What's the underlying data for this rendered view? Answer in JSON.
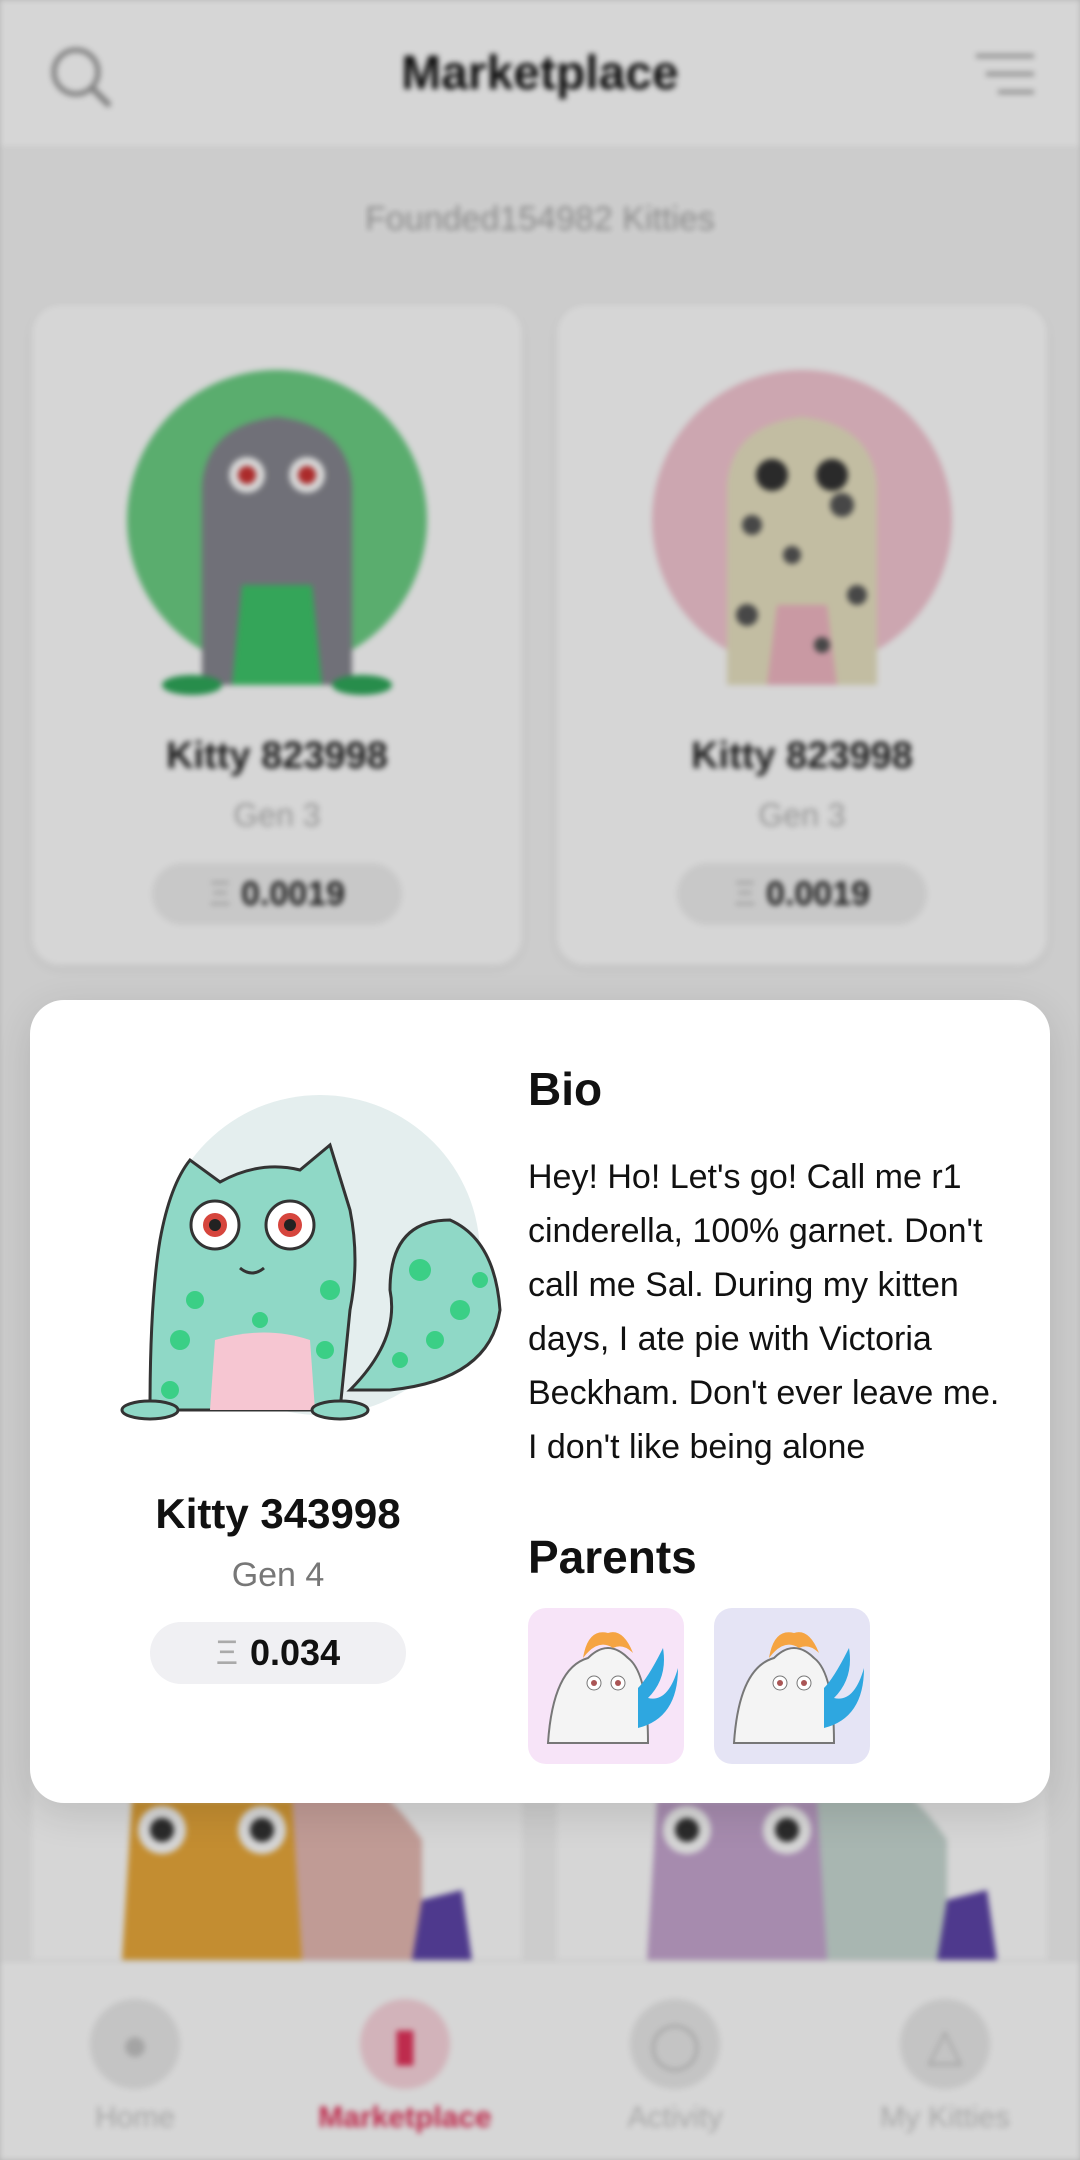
{
  "header": {
    "title": "Marketplace",
    "search_icon": "search-icon",
    "filter_icon": "filter-icon"
  },
  "found_text": "Founded154982 Kitties",
  "grid": [
    {
      "name": "Kitty 823998",
      "gen": "Gen 3",
      "price": "0.0019",
      "bg": "#6cce84"
    },
    {
      "name": "Kitty 823998",
      "gen": "Gen 3",
      "price": "0.0019",
      "bg": "#f4c6d2"
    }
  ],
  "modal": {
    "name": "Kitty 343998",
    "gen": "Gen 4",
    "price": "0.034",
    "currency_symbol": "Ξ",
    "bio_title": "Bio",
    "bio": "Hey! Ho! Let's go! Call me r1 cinderella, 100% garnet. Don't call me Sal. During my kitten days, I ate pie with Victoria Beckham. Don't ever leave me. I don't like being alone",
    "parents_title": "Parents",
    "parents": [
      {
        "bg": "#f7e4f8"
      },
      {
        "bg": "#e5e4f5"
      }
    ]
  },
  "nav": [
    {
      "label": "Home",
      "icon": "home-icon"
    },
    {
      "label": "Marketplace",
      "icon": "store-icon",
      "active": true
    },
    {
      "label": "Activity",
      "icon": "activity-icon"
    },
    {
      "label": "My Kitties",
      "icon": "kitties-icon"
    }
  ],
  "colors": {
    "accent": "#e3345c",
    "ink": "#111111"
  }
}
